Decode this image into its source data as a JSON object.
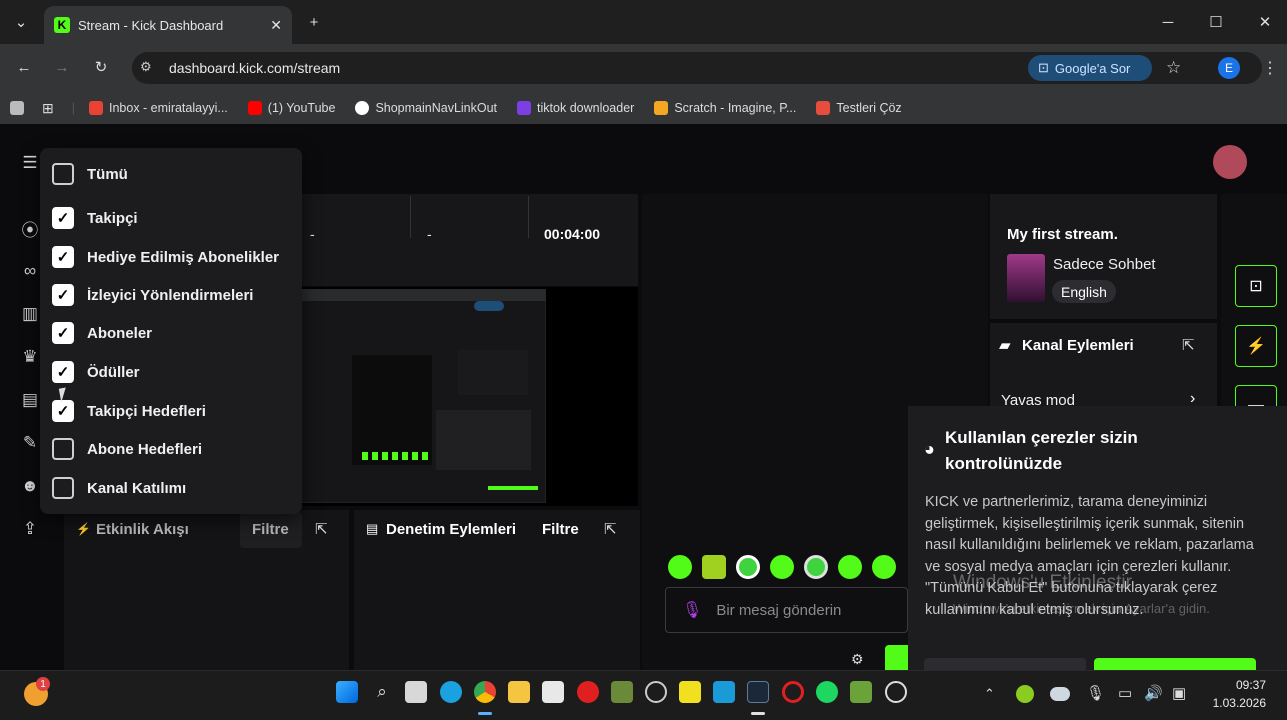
{
  "browser": {
    "tab_title": "Stream - Kick Dashboard",
    "url": "dashboard.kick.com/stream",
    "google_ask": "Google'a Sor",
    "profile_initial": "E",
    "bookmarks": [
      {
        "label": "Inbox - emiratalayyi...",
        "color": "#ea4335"
      },
      {
        "label": "(1) YouTube",
        "color": "#ff0000"
      },
      {
        "label": "ShopmainNavLinkOut",
        "color": "#ffffff"
      },
      {
        "label": "tiktok downloader",
        "color": "#7b3fe4"
      },
      {
        "label": "Scratch - Imagine, P...",
        "color": "#f5a623"
      },
      {
        "label": "Testleri Çöz",
        "color": "#e74c3c"
      }
    ]
  },
  "timeline": {
    "time": "00:04:00",
    "dash1": "-",
    "dash2": "-"
  },
  "filter_dropdown": {
    "options": [
      {
        "label": "Tümü",
        "checked": false
      },
      {
        "label": "Takipçi",
        "checked": true
      },
      {
        "label": "Hediye Edilmiş Abonelikler",
        "checked": true
      },
      {
        "label": "İzleyici Yönlendirmeleri",
        "checked": true
      },
      {
        "label": "Aboneler",
        "checked": true
      },
      {
        "label": "Ödüller",
        "checked": true
      },
      {
        "label": "Takipçi Hedefleri",
        "checked": true
      },
      {
        "label": "Abone Hedefleri",
        "checked": false
      },
      {
        "label": "Kanal Katılımı",
        "checked": false
      }
    ]
  },
  "activity": {
    "title": "Etkinlik Akışı",
    "filter": "Filtre"
  },
  "moderation": {
    "title": "Denetim Eylemleri",
    "filter": "Filtre"
  },
  "stream_info": {
    "title": "My first stream.",
    "category": "Sadece Sohbet",
    "language": "English"
  },
  "channel_actions": {
    "title": "Kanal Eylemleri",
    "slow_mode": "Yavas mod"
  },
  "chat": {
    "placeholder": "Bir mesaj gönderin"
  },
  "cookie": {
    "title": "Kullanılan çerezler sizin kontrolünüzde",
    "body": "KICK ve partnerlerimiz, tarama deneyiminizi geliştirmek, kişiselleştirilmiş içerik sunmak, sitenin nasıl kullanıldığını belirlemek ve reklam, pazarlama ve sosyal medya amaçları için çerezleri kullanır. \"Tümünü Kabul Et\" butonuna tıklayarak çerez kullanımını kabul etmiş olursunuz.",
    "watermark1": "Windows'u Etkinleştir",
    "watermark2": "Windows'u etkinleştirmek için Ayarlar'a gidin."
  },
  "taskbar": {
    "time": "09:37",
    "date": "1.03.2026",
    "notif_count": "1"
  }
}
